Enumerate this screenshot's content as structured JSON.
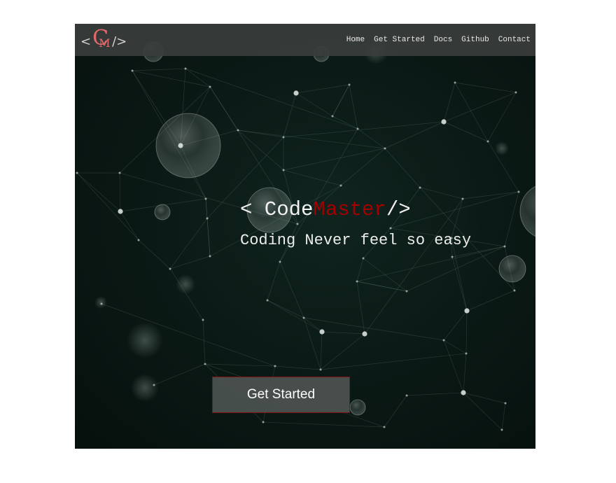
{
  "navbar": {
    "logo": {
      "open_bracket": "<",
      "monogram_c": "C",
      "monogram_m": "M",
      "close_bracket": "/>"
    },
    "links": [
      "Home",
      "Get Started",
      "Docs",
      "Github",
      "Contact"
    ]
  },
  "hero": {
    "title_prefix": "< Code",
    "title_accent": "Master",
    "title_suffix": "/>",
    "subtitle": "Coding Never feel so easy",
    "cta_label": "Get Started"
  },
  "colors": {
    "background": "#0b1a16",
    "navbar": "#3a3e3c",
    "accent": "#a40000",
    "logo_accent": "#e26a6a",
    "text": "#f2f2f2"
  },
  "icons": {
    "background": "network-nodes-graphic"
  }
}
